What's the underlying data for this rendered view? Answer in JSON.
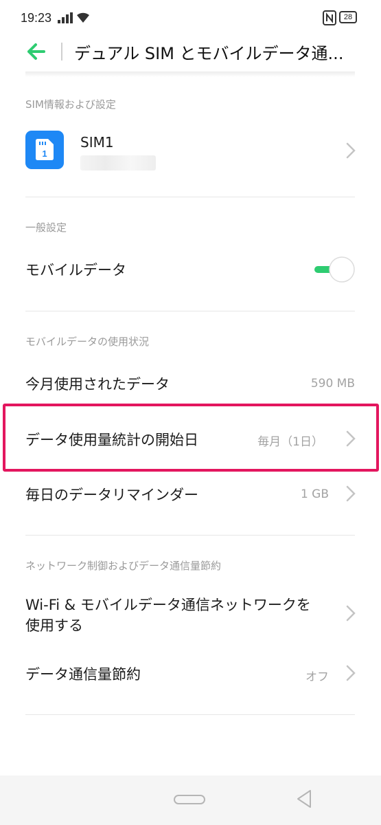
{
  "status_bar": {
    "time": "19:23",
    "battery": "28"
  },
  "header": {
    "title": "デュアル SIM とモバイルデータ通..."
  },
  "sections": {
    "sim_info": {
      "label": "SIM情報および設定",
      "sim_name": "SIM1",
      "sim_icon_number": "1"
    },
    "general": {
      "label": "一般設定",
      "mobile_data_label": "モバイルデータ",
      "mobile_data_on": true
    },
    "usage": {
      "label": "モバイルデータの使用状況",
      "this_month_label": "今月使用されたデータ",
      "this_month_value": "590 MB",
      "cycle_label": "データ使用量統計の開始日",
      "cycle_value": "毎月（1日）",
      "daily_reminder_label": "毎日のデータリマインダー",
      "daily_reminder_value": "1 GB"
    },
    "network": {
      "label": "ネットワーク制御およびデータ通信量節約",
      "wifi_mobile_label_line1": "Wi-Fi & モバイルデータ通信ネットワークを",
      "wifi_mobile_label_line2": "使用する",
      "data_saver_label": "データ通信量節約",
      "data_saver_value": "オフ"
    }
  },
  "colors": {
    "accent": "#2ecc71",
    "sim_icon": "#1e88f5",
    "highlight": "#e3165e"
  }
}
